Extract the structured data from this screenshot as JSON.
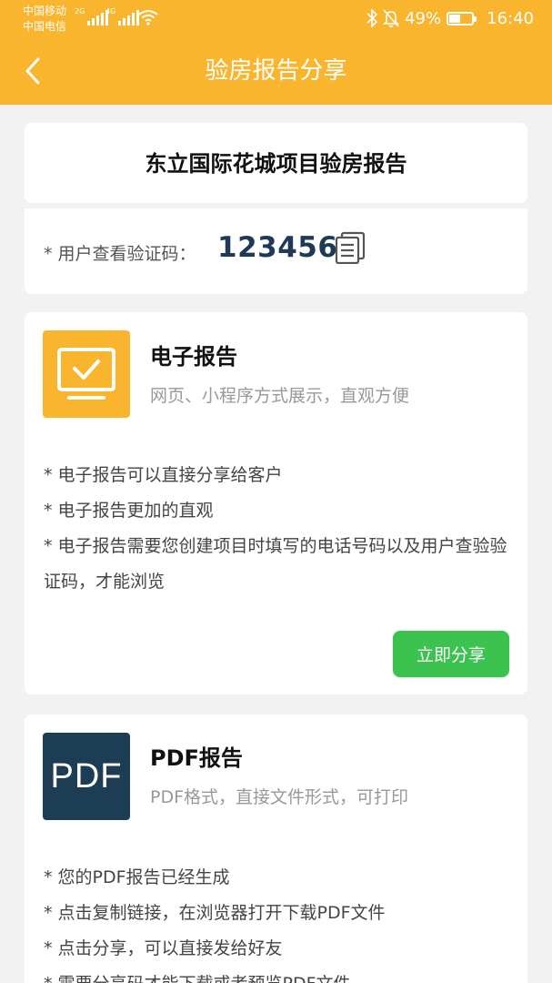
{
  "status_bar": {
    "carrier1": "中国移动",
    "carrier2": "中国电信",
    "net1": "2G",
    "net2": "4G",
    "battery_percent": "49%",
    "time": "16:40"
  },
  "header": {
    "title": "验房报告分享",
    "back_icon": "chevron-left-icon",
    "color": "#f9b52d"
  },
  "report": {
    "title": "东立国际花城项目验房报告",
    "code_label": "* 用户查看验证码：",
    "code_value": "123456",
    "copy_icon": "copy-icon"
  },
  "electronic": {
    "icon": "monitor-check-icon",
    "title": "电子报告",
    "subtitle": "网页、小程序方式展示，直观方便",
    "bullets": [
      "* 电子报告可以直接分享给客户",
      "* 电子报告更加的直观",
      "* 电子报告需要您创建项目时填写的电话号码以及用户查验验证码，才能浏览"
    ],
    "share_label": "立即分享",
    "button_color": "#3cc34f"
  },
  "pdf": {
    "icon_text": "PDF",
    "title": "PDF报告",
    "subtitle": "PDF格式，直接文件形式，可打印",
    "bullets": [
      "* 您的PDF报告已经生成",
      "* 点击复制链接，在浏览器打开下载PDF文件",
      "* 点击分享，可以直接发给好友",
      "* 需要分享码才能下载或者预览PDF文件"
    ]
  }
}
